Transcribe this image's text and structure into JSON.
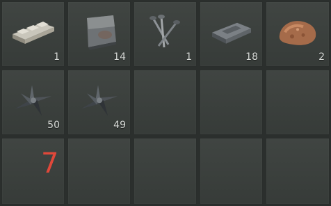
{
  "inventory": {
    "slots": [
      {
        "item": "metal-bars-icon",
        "quantity": "1"
      },
      {
        "item": "metal-plate-icon",
        "quantity": "14"
      },
      {
        "item": "nails-icon",
        "quantity": "1"
      },
      {
        "item": "metal-ingot-icon",
        "quantity": "18"
      },
      {
        "item": "ore-icon",
        "quantity": "2"
      },
      {
        "item": "shuriken-icon",
        "quantity": "50"
      },
      {
        "item": "shuriken-icon",
        "quantity": "49"
      }
    ],
    "hotkey_label": "7"
  },
  "colors": {
    "background": "#2b2f2d",
    "slot": "#3a3f3c",
    "quantity_text": "#d8dbd8",
    "hotkey": "#e0483a"
  }
}
